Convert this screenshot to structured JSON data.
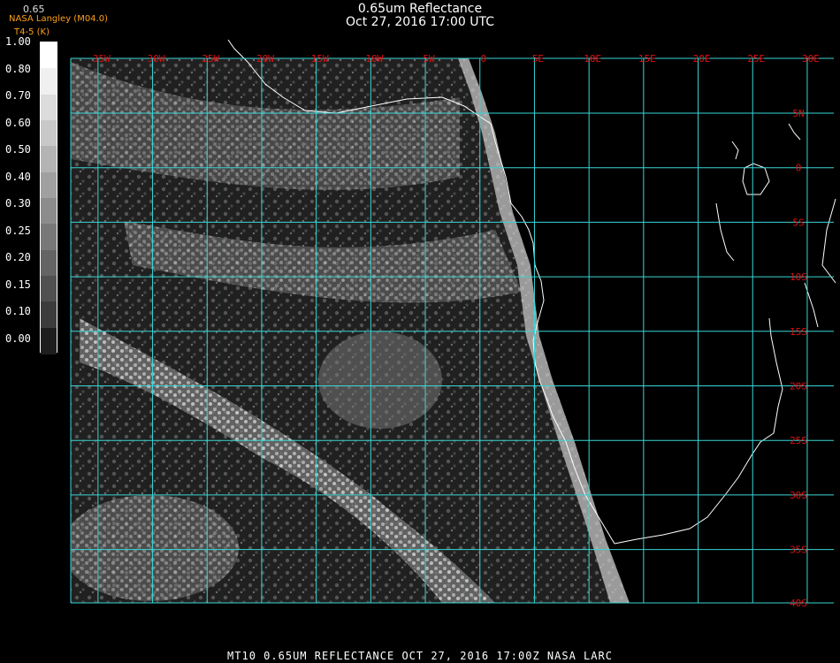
{
  "header": {
    "title": "0.65um Reflectance",
    "datetime": "Oct 27, 2016 17:00 UTC",
    "org": "NASA Langley (M04.0)",
    "unit": "T4-5 (K)",
    "value_readout": "0.65"
  },
  "colorbar": {
    "labels": [
      "1.00",
      "0.80",
      "0.70",
      "0.60",
      "0.50",
      "0.40",
      "0.30",
      "0.25",
      "0.20",
      "0.15",
      "0.10",
      "0.00"
    ],
    "shades": [
      "#ffffff",
      "#f0f0f0",
      "#dcdcdc",
      "#c8c8c8",
      "#b4b4b4",
      "#a0a0a0",
      "#8c8c8c",
      "#787878",
      "#646464",
      "#505050",
      "#3c3c3c",
      "#1e1e1e"
    ]
  },
  "map": {
    "lon_labels": [
      "35W",
      "30W",
      "25W",
      "20W",
      "15W",
      "10W",
      "5W",
      "0",
      "5E",
      "10E",
      "15E",
      "20E",
      "25E",
      "30E",
      "35E"
    ],
    "lat_labels": [
      "5N",
      "0",
      "5S",
      "10S",
      "15S",
      "20S",
      "25S",
      "30S",
      "35S",
      "40S"
    ],
    "grid_color": "#39d6d6",
    "label_color": "#e01010",
    "coast_color": "#ffffff"
  },
  "footer": {
    "text": "MT10  0.65UM REFLECTANCE   OCT 27, 2016 17:00Z   NASA LARC"
  }
}
